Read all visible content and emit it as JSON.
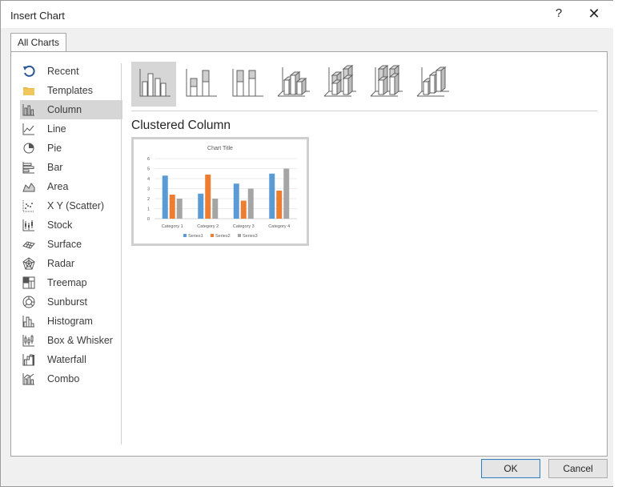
{
  "window": {
    "title": "Insert Chart",
    "help_glyph": "?",
    "close_glyph": "✕"
  },
  "tabs": [
    {
      "label": "All Charts",
      "active": true
    }
  ],
  "sidebar": {
    "items": [
      {
        "label": "Recent",
        "icon": "recent-icon"
      },
      {
        "label": "Templates",
        "icon": "folder-icon"
      },
      {
        "label": "Column",
        "icon": "column-chart-icon",
        "selected": true
      },
      {
        "label": "Line",
        "icon": "line-chart-icon"
      },
      {
        "label": "Pie",
        "icon": "pie-chart-icon"
      },
      {
        "label": "Bar",
        "icon": "bar-chart-icon"
      },
      {
        "label": "Area",
        "icon": "area-chart-icon"
      },
      {
        "label": "X Y (Scatter)",
        "icon": "scatter-chart-icon"
      },
      {
        "label": "Stock",
        "icon": "stock-chart-icon"
      },
      {
        "label": "Surface",
        "icon": "surface-chart-icon"
      },
      {
        "label": "Radar",
        "icon": "radar-chart-icon"
      },
      {
        "label": "Treemap",
        "icon": "treemap-chart-icon"
      },
      {
        "label": "Sunburst",
        "icon": "sunburst-chart-icon"
      },
      {
        "label": "Histogram",
        "icon": "histogram-chart-icon"
      },
      {
        "label": "Box & Whisker",
        "icon": "box-whisker-chart-icon"
      },
      {
        "label": "Waterfall",
        "icon": "waterfall-chart-icon"
      },
      {
        "label": "Combo",
        "icon": "combo-chart-icon"
      }
    ]
  },
  "subtypes": [
    {
      "icon": "clustered-column-icon",
      "selected": true
    },
    {
      "icon": "stacked-column-icon"
    },
    {
      "icon": "100-stacked-column-icon"
    },
    {
      "icon": "3d-clustered-column-icon"
    },
    {
      "icon": "3d-stacked-column-icon"
    },
    {
      "icon": "3d-100-stacked-column-icon"
    },
    {
      "icon": "3d-column-icon"
    }
  ],
  "selected_subtype_name": "Clustered Column",
  "chart_data": {
    "type": "bar",
    "title": "Chart Title",
    "categories": [
      "Category 1",
      "Category 2",
      "Category 3",
      "Category 4"
    ],
    "series": [
      {
        "name": "Series1",
        "values": [
          4.3,
          2.5,
          3.5,
          4.5
        ],
        "color": "#5b9bd5"
      },
      {
        "name": "Series2",
        "values": [
          2.4,
          4.4,
          1.8,
          2.8
        ],
        "color": "#ed7d31"
      },
      {
        "name": "Series3",
        "values": [
          2.0,
          2.0,
          3.0,
          5.0
        ],
        "color": "#a5a5a5"
      }
    ],
    "ylim": [
      0,
      6
    ],
    "yticks": [
      "0",
      "1",
      "2",
      "3",
      "4",
      "5",
      "6"
    ],
    "grid": true,
    "legend": "bottom"
  },
  "buttons": {
    "ok": "OK",
    "cancel": "Cancel"
  },
  "colors": {
    "selection": "#d6d6d6",
    "ok_border": "#3c7fb1"
  }
}
